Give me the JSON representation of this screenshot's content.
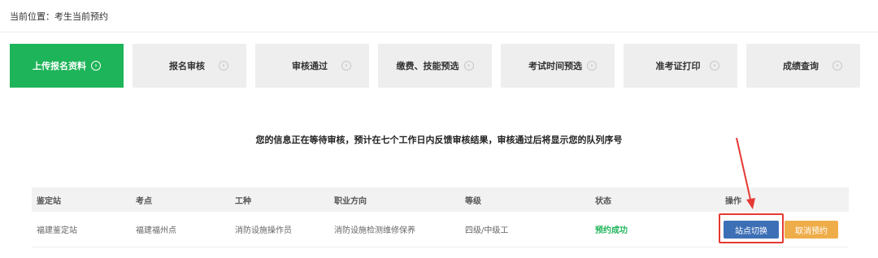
{
  "breadcrumb": {
    "text": "当前位置：考生当前预约"
  },
  "steps": [
    {
      "label": "上传报名资料",
      "active": true
    },
    {
      "label": "报名审核",
      "active": false
    },
    {
      "label": "审核通过",
      "active": false
    },
    {
      "label": "缴费、技能预选",
      "active": false
    },
    {
      "label": "考试时间预选",
      "active": false
    },
    {
      "label": "准考证打印",
      "active": false
    },
    {
      "label": "成绩查询",
      "active": false
    }
  ],
  "notice": "您的信息正在等待审核，预计在七个工作日内反馈审核结果，审核通过后将显示您的队列序号",
  "table": {
    "headers": [
      "鉴定站",
      "考点",
      "工种",
      "职业方向",
      "等级",
      "状态",
      "操作"
    ],
    "row": {
      "station": "福建鉴定站",
      "site": "福建福州点",
      "job": "消防设施操作员",
      "direction": "消防设施检测维修保养",
      "level": "四级/中级工",
      "status": "预约成功"
    },
    "actions": {
      "switch_label": "站点切换",
      "cancel_label": "取消预约"
    }
  },
  "colors": {
    "active_step": "#1eb459",
    "success": "#1eb459",
    "switch_button": "#3d6fb6",
    "cancel_button": "#efad4a",
    "highlight": "#e53935"
  },
  "icons": {
    "step_arrow": "circle-chevron-right-icon"
  }
}
